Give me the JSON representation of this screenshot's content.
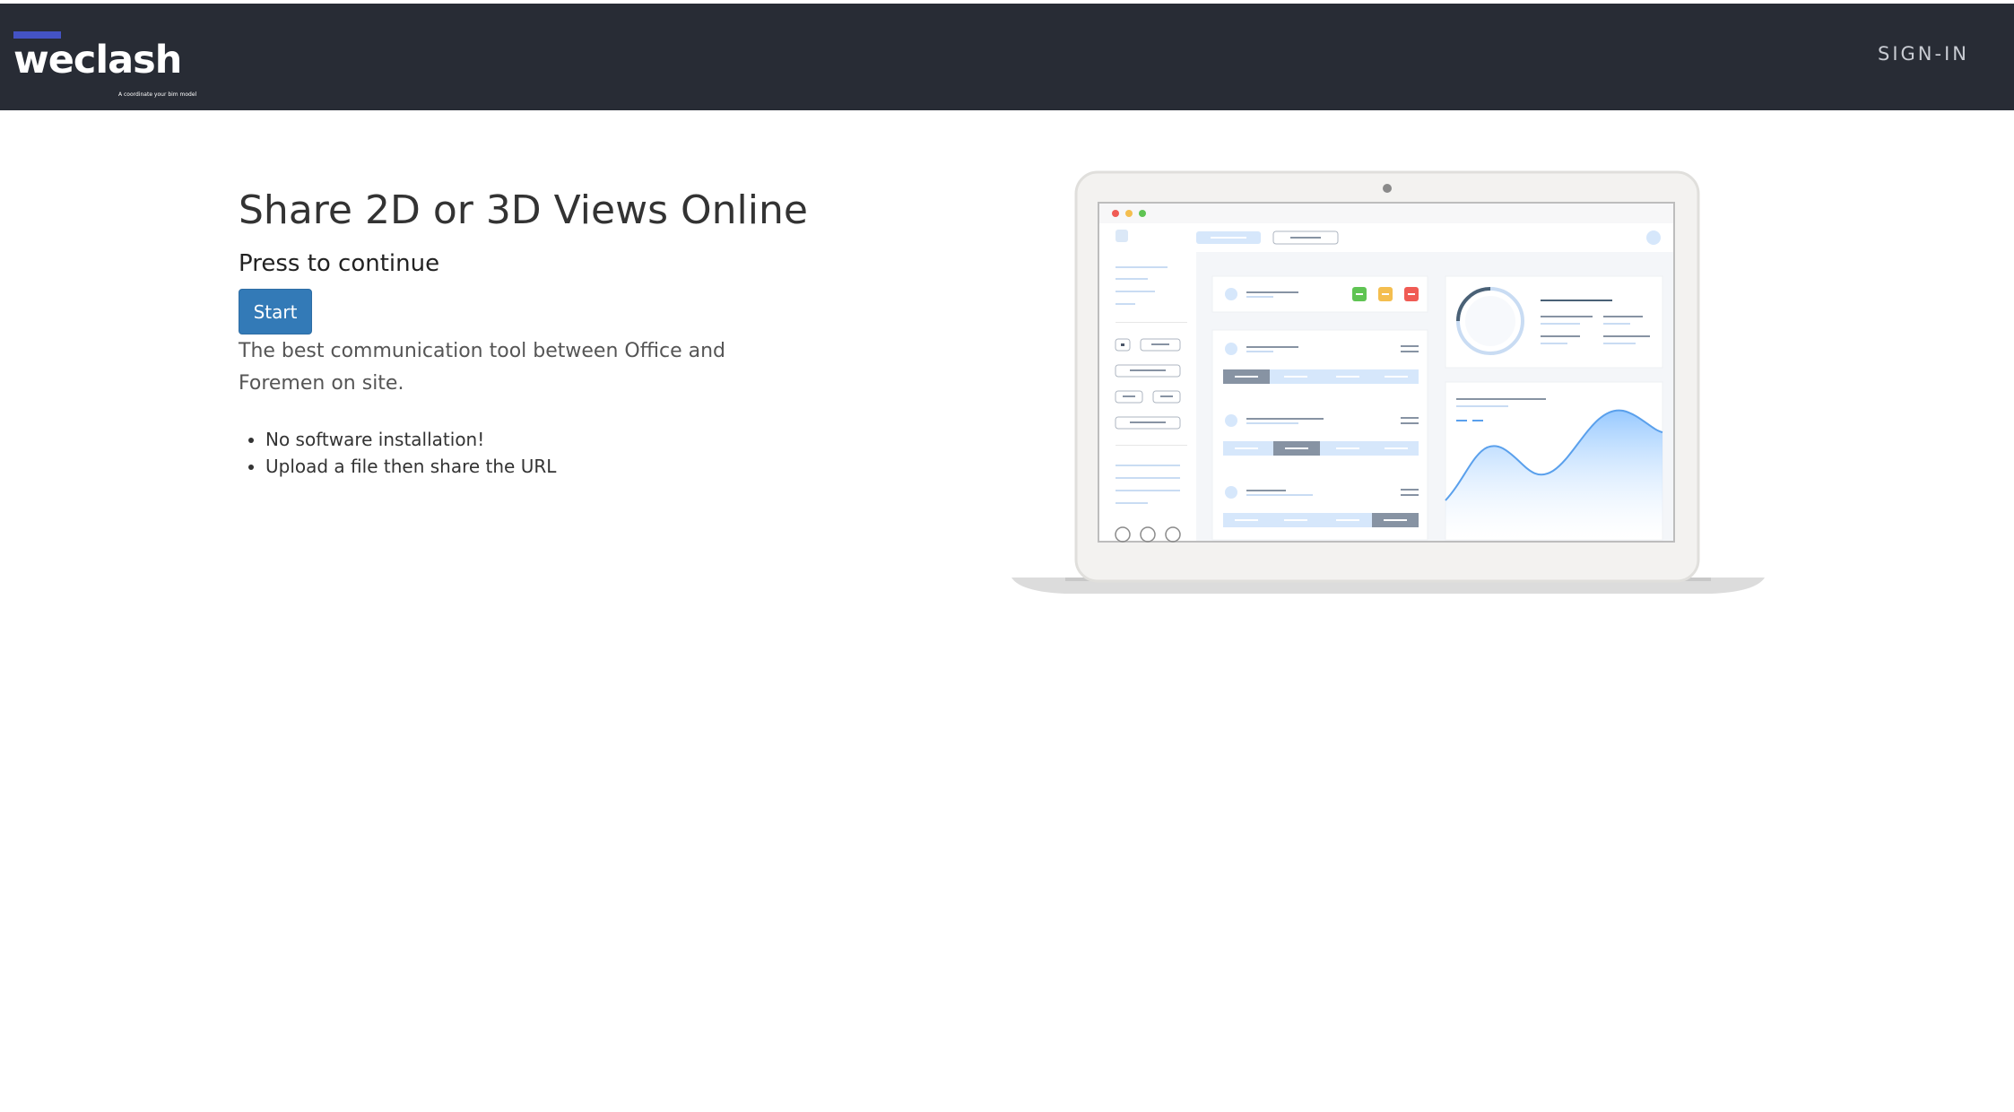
{
  "navbar": {
    "logo_text": "weclash",
    "logo_tagline": "A coordinate your bim model",
    "signin_label": "SIGN-IN"
  },
  "hero": {
    "title": "Share 2D or 3D Views Online",
    "subtitle": "Press to continue",
    "start_label": "Start",
    "description": "The best communication tool between Office and Foremen on site.",
    "features": [
      "No software installation!",
      "Upload a file then share the URL"
    ]
  },
  "colors": {
    "navbar_bg": "#282c35",
    "logo_accent": "#4453c4",
    "primary_button": "#337ab7"
  },
  "icons": {
    "illustration": "laptop-dashboard-illustration"
  }
}
